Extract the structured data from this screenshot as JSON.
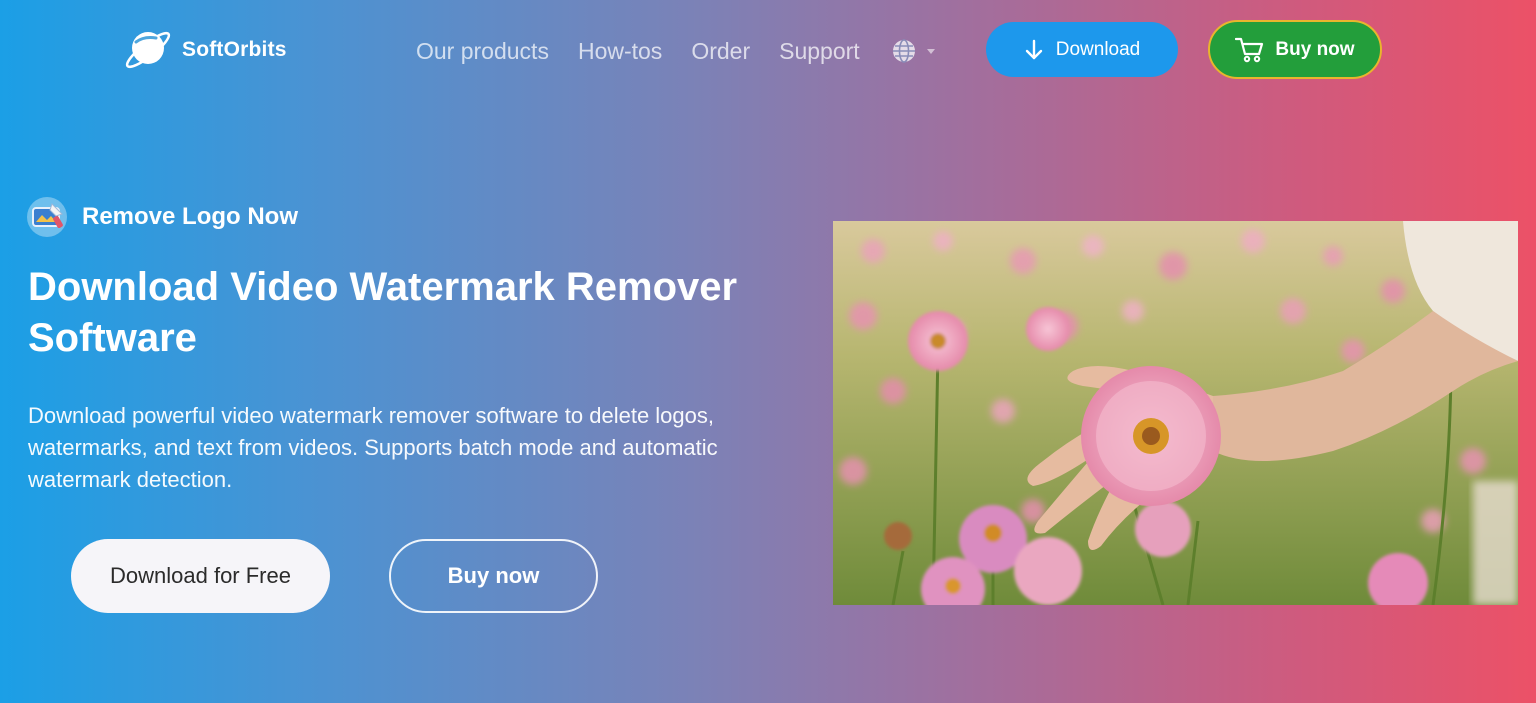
{
  "brand": {
    "name": "SoftOrbits"
  },
  "nav": {
    "items": [
      "Our products",
      "How-tos",
      "Order",
      "Support"
    ],
    "language_icon": "globe-icon"
  },
  "header_buttons": {
    "download_label": "Download",
    "buy_label": "Buy now"
  },
  "hero": {
    "badge": "Remove Logo Now",
    "title": "Download Video Watermark Remover Software",
    "description": "Download powerful video watermark remover software to delete logos, watermarks, and text from videos. Supports batch mode and automatic watermark detection.",
    "primary_button": "Download for Free",
    "secondary_button": "Buy now"
  },
  "colors": {
    "gradient_start": "#1b9fe6",
    "gradient_end": "#ec5167",
    "download_button": "#1d98ec",
    "buy_button": "#239e3b",
    "buy_button_border": "#e9b52d"
  }
}
